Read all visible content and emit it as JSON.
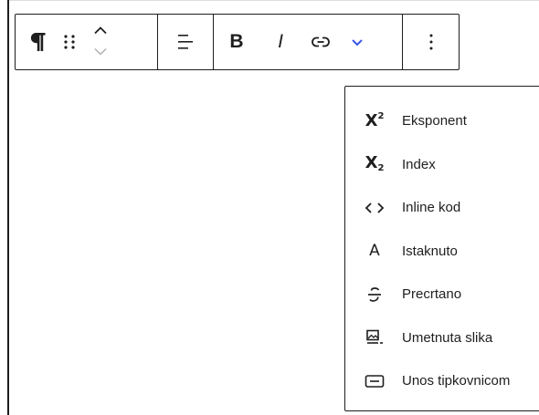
{
  "toolbar": {
    "paragraph_icon": "paragraph-icon",
    "drag_icon": "drag-handle-icon",
    "move_up_icon": "chevron-up-icon",
    "move_down_icon": "chevron-down-icon",
    "align_icon": "align-left-icon",
    "bold_label": "B",
    "italic_label": "I",
    "link_icon": "link-icon",
    "more_formats_icon": "chevron-down-icon",
    "options_icon": "more-vertical-icon",
    "accent_color": "#3858e9"
  },
  "format_menu": {
    "items": [
      {
        "label": "Eksponent",
        "icon": "superscript-icon"
      },
      {
        "label": "Index",
        "icon": "subscript-icon"
      },
      {
        "label": "Inline kod",
        "icon": "code-icon"
      },
      {
        "label": "Istaknuto",
        "icon": "highlight-icon"
      },
      {
        "label": "Precrtano",
        "icon": "strikethrough-icon"
      },
      {
        "label": "Umetnuta slika",
        "icon": "inline-image-icon"
      },
      {
        "label": "Unos tipkovnicom",
        "icon": "keyboard-icon"
      }
    ]
  },
  "glyphs": {
    "superscript_base": "X",
    "superscript_exp": "2",
    "subscript_base": "X",
    "subscript_idx": "2",
    "highlight_letter": "A"
  }
}
